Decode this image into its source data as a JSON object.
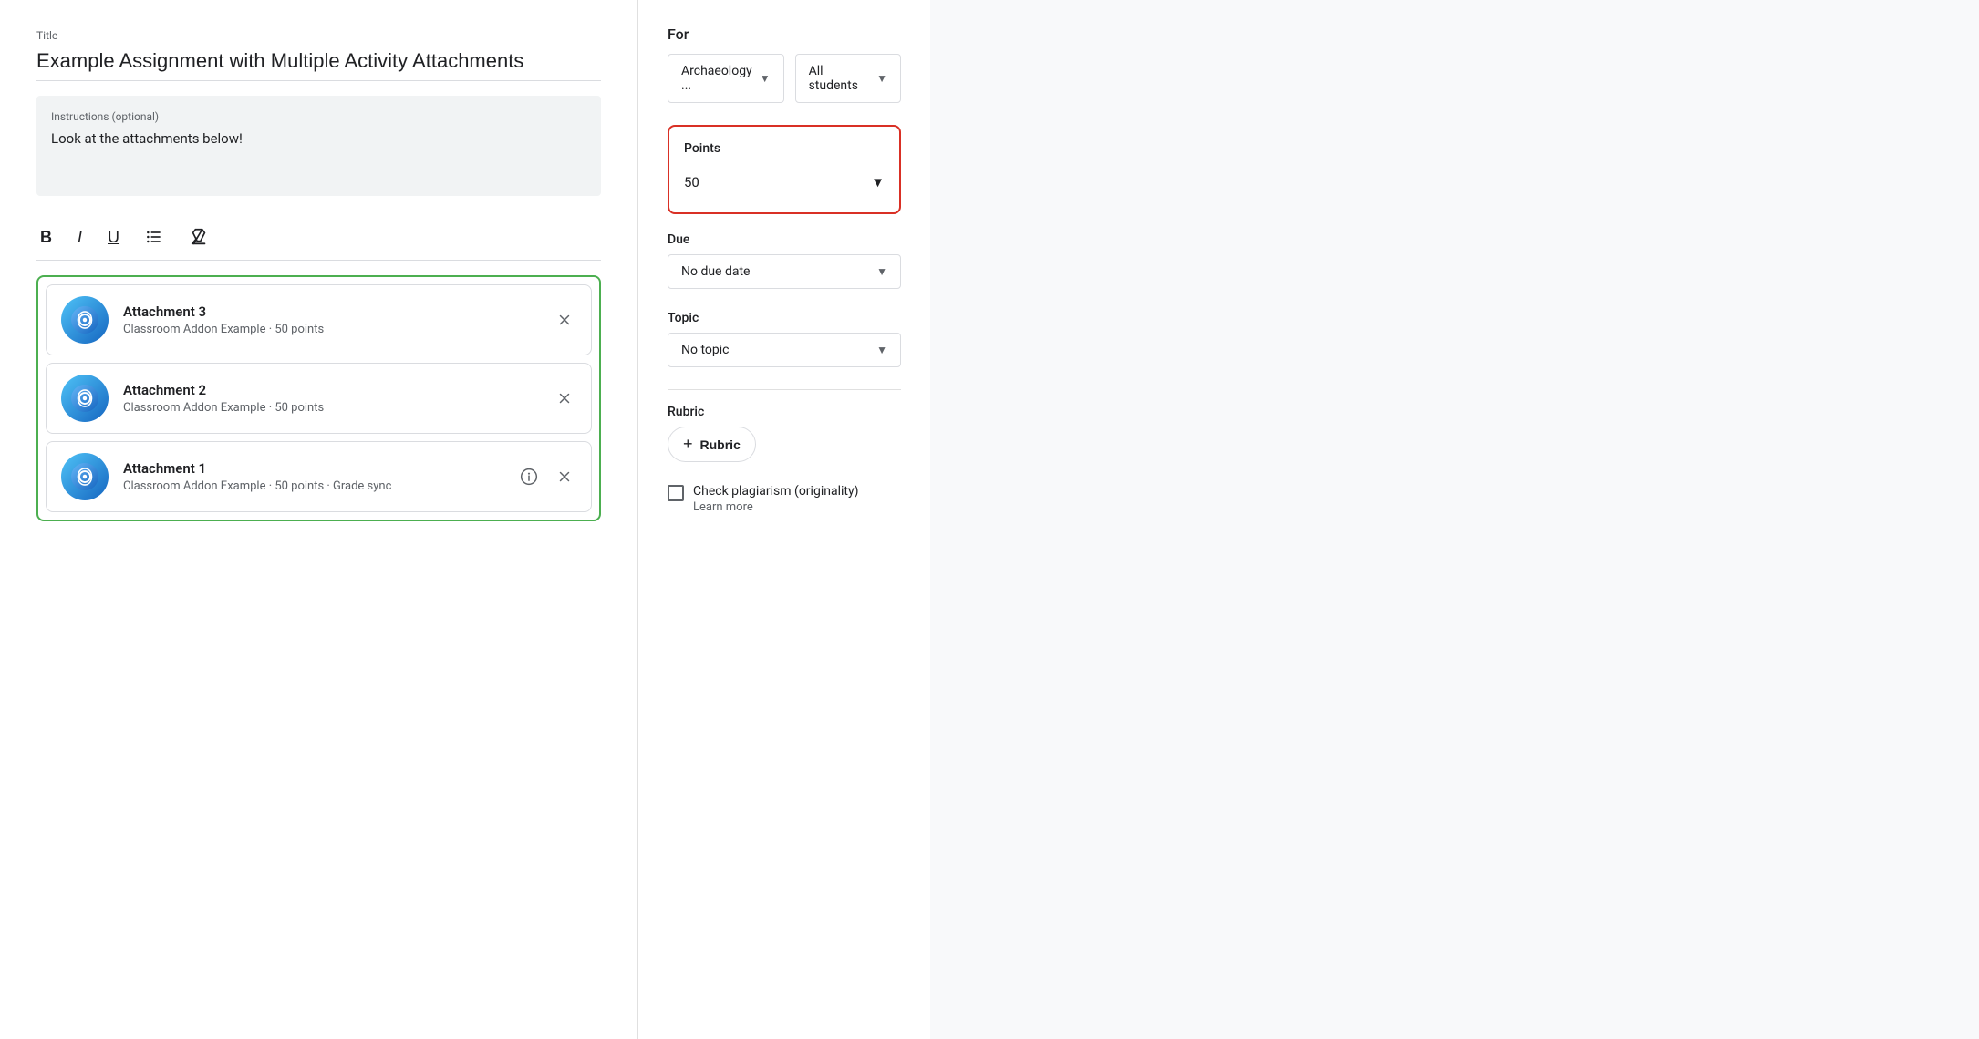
{
  "main": {
    "title_label": "Title",
    "title_value": "Example Assignment with Multiple Activity Attachments",
    "instructions_label": "Instructions (optional)",
    "instructions_value": "Look at the attachments below!",
    "toolbar": {
      "bold": "B",
      "italic": "I",
      "underline": "U",
      "list": "≡",
      "clear": "✕"
    },
    "attachments": [
      {
        "name": "Attachment 3",
        "meta": "Classroom Addon Example · 50 points",
        "has_info": false
      },
      {
        "name": "Attachment 2",
        "meta": "Classroom Addon Example · 50 points",
        "has_info": false
      },
      {
        "name": "Attachment 1",
        "meta": "Classroom Addon Example · 50 points · Grade sync",
        "has_info": true
      }
    ]
  },
  "sidebar": {
    "for_label": "For",
    "class_dropdown": "Archaeology ...",
    "students_dropdown": "All students",
    "points_label": "Points",
    "points_value": "50",
    "due_label": "Due",
    "due_value": "No due date",
    "topic_label": "Topic",
    "topic_value": "No topic",
    "rubric_label": "Rubric",
    "rubric_button": "Rubric",
    "plagiarism_label": "Check plagiarism (originality)",
    "learn_more": "Learn more"
  }
}
